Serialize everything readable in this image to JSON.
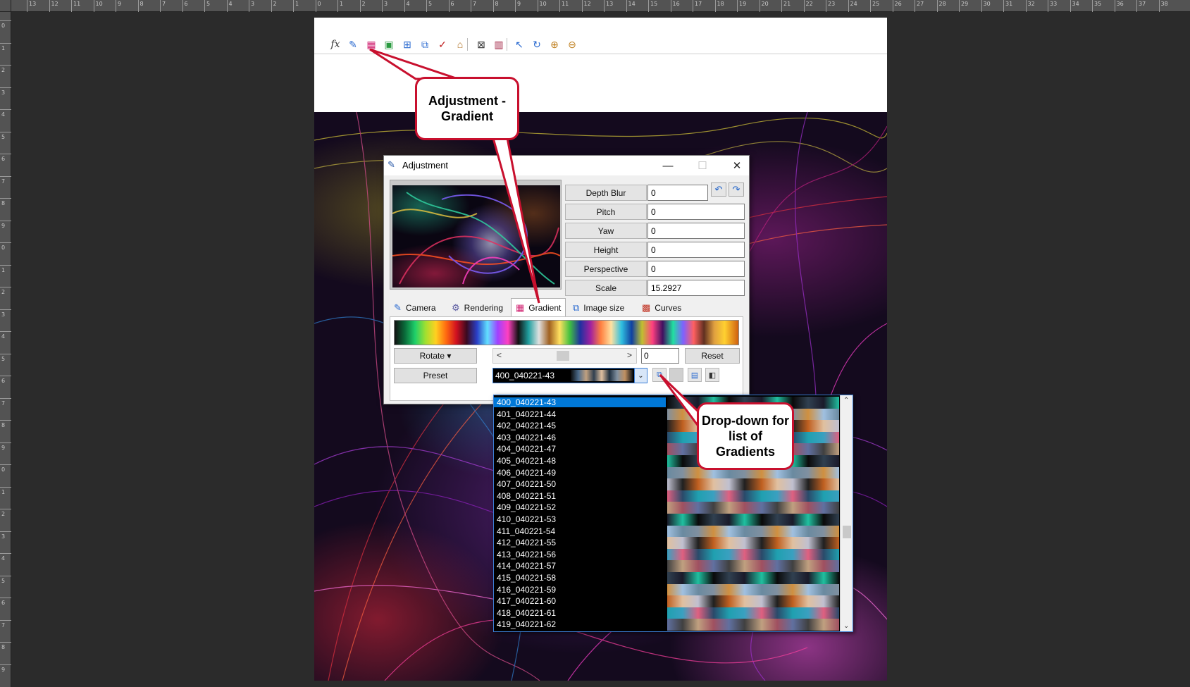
{
  "ruler": {
    "top_labels": [
      "13",
      "12",
      "11",
      "10",
      "9",
      "8",
      "7",
      "6",
      "5",
      "4",
      "3",
      "2",
      "1",
      "0",
      "1",
      "2",
      "3",
      "4",
      "5",
      "6",
      "7",
      "8",
      "9",
      "10",
      "11",
      "12",
      "13",
      "14",
      "15",
      "16",
      "17",
      "18",
      "19",
      "20",
      "21",
      "22",
      "23",
      "24",
      "25",
      "26",
      "27",
      "28",
      "29",
      "30",
      "31",
      "32",
      "33",
      "34",
      "35",
      "36",
      "37",
      "38"
    ],
    "left_labels": [
      "0",
      "1",
      "2",
      "3",
      "4",
      "5",
      "6",
      "7",
      "8",
      "9",
      "0",
      "1",
      "2",
      "3",
      "4",
      "5",
      "6",
      "7",
      "8",
      "9",
      "0",
      "1",
      "2",
      "3",
      "4",
      "5",
      "6",
      "7",
      "8",
      "9"
    ]
  },
  "app_toolbar": {
    "icons": [
      "fx-icon",
      "edit-icon",
      "gradient-grid-icon",
      "color-square-icon",
      "grid-icon",
      "layers-icon",
      "document-check-icon",
      "folder-open-icon",
      "frame-icon",
      "grid-frame-icon",
      "pointer-icon",
      "refresh-icon",
      "zoom-in-icon",
      "zoom-out-icon"
    ],
    "fx_label": "fx"
  },
  "window": {
    "title": "Adjustment",
    "minimize": "—",
    "maximize": "☐",
    "close": "✕"
  },
  "properties": [
    {
      "label": "Depth Blur",
      "value": "0"
    },
    {
      "label": "Pitch",
      "value": "0"
    },
    {
      "label": "Yaw",
      "value": "0"
    },
    {
      "label": "Height",
      "value": "0"
    },
    {
      "label": "Perspective",
      "value": "0"
    },
    {
      "label": "Scale",
      "value": "15.2927"
    }
  ],
  "undo_symbol": "↶",
  "redo_symbol": "↷",
  "tabs": [
    {
      "label": "Camera",
      "icon": "camera-edit-icon",
      "glyph": "✎"
    },
    {
      "label": "Rendering",
      "icon": "gear-icon",
      "glyph": "⚙"
    },
    {
      "label": "Gradient",
      "icon": "gradient-grid-icon",
      "glyph": "▦"
    },
    {
      "label": "Image size",
      "icon": "image-size-icon",
      "glyph": "⧉"
    },
    {
      "label": "Curves",
      "icon": "curves-icon",
      "glyph": "▩"
    }
  ],
  "active_tab": "Gradient",
  "gradient_panel": {
    "rotate_label": "Rotate ▾",
    "scroll_left": "<",
    "scroll_right": ">",
    "rotate_value": "0",
    "reset_label": "Reset",
    "preset_label": "Preset",
    "preset_value": "400_040221-43",
    "dropdown_arrow": "⌄"
  },
  "preset_list": {
    "items": [
      "400_040221-43",
      "401_040221-44",
      "402_040221-45",
      "403_040221-46",
      "404_040221-47",
      "405_040221-48",
      "406_040221-49",
      "407_040221-50",
      "408_040221-51",
      "409_040221-52",
      "410_040221-53",
      "411_040221-54",
      "412_040221-55",
      "413_040221-56",
      "414_040221-57",
      "415_040221-58",
      "416_040221-59",
      "417_040221-60",
      "418_040221-61",
      "419_040221-62"
    ],
    "selected": "400_040221-43",
    "scroll_up": "⌃",
    "scroll_down": "⌄"
  },
  "callouts": {
    "adjustment_gradient": "Adjustment - Gradient",
    "dropdown": "Drop-down for list of Gradients"
  },
  "colors": {
    "callout_border": "#c8102e",
    "selection": "#0078d7",
    "accent": "#3c7fd6"
  }
}
